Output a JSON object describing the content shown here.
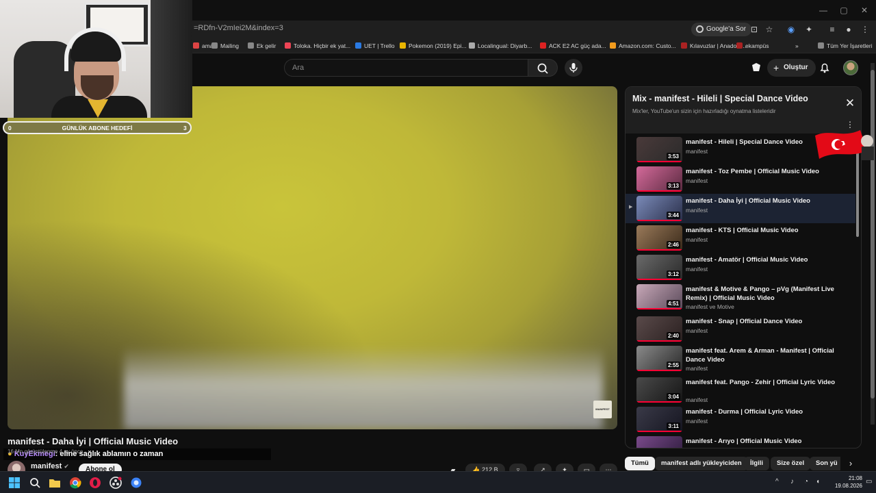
{
  "browser": {
    "url": "=RDfn-V2mIei2M&index=3",
    "google_ask": "Google'a Sor",
    "window_controls": [
      "—",
      "▢",
      "✕"
    ]
  },
  "bookmarks": [
    {
      "label": "ama",
      "color": "#d44"
    },
    {
      "label": "Mailing",
      "color": "#888"
    },
    {
      "label": "Ek gelir",
      "color": "#888"
    },
    {
      "label": "Toloka. Hiçbir ek yat...",
      "color": "#e45"
    },
    {
      "label": "UET | Trello",
      "color": "#2a7ae2"
    },
    {
      "label": "Pokemon (2019) Epi...",
      "color": "#e8b400"
    },
    {
      "label": "Localingual: Diyarb...",
      "color": "#aaa"
    },
    {
      "label": "ACK E2 AC güç ada...",
      "color": "#d22"
    },
    {
      "label": "Amazon.com: Custo...",
      "color": "#f29b1d"
    },
    {
      "label": "Kılavuzlar | Anadolu...",
      "color": "#a22"
    },
    {
      "label": "ekampüs",
      "color": "#a22"
    },
    {
      "label": "»",
      "color": ""
    },
    {
      "label": "Tüm Yer İşaretleri",
      "color": "#888"
    }
  ],
  "youtube": {
    "search_placeholder": "Ara",
    "create_label": "Oluştur"
  },
  "webcam": {
    "goal_label": "GÜNLÜK ABONE HEDEFİ",
    "goal_current": "0",
    "goal_target": "3"
  },
  "video": {
    "title": "manifest - Daha İyi | Official Music Video",
    "channel": "manifest",
    "subscribe_label": "Abone ol",
    "likes": "212 B",
    "chat_user": "KuyEkmegi",
    "chat_text": ": eline sağlık ablamın o zaman",
    "chat_ghost": "16 Mn görüntülenme  4 ay önce",
    "watermark": "MANIFEST"
  },
  "playlist": {
    "title": "Mix - manifest - Hileli | Special Dance Video",
    "subtitle": "Mix'ler, YouTube'un sizin için hazırladığı oynatma listeleridir",
    "items": [
      {
        "title": "manifest - Hileli | Special Dance Video",
        "channel": "manifest",
        "duration": "3:53",
        "active": false,
        "c1": "#4a3a3a",
        "c2": "#2a2a2a"
      },
      {
        "title": "manifest - Toz Pembe | Official Music Video",
        "channel": "manifest",
        "duration": "3:13",
        "active": false,
        "c1": "#d46a9a",
        "c2": "#5a2a40"
      },
      {
        "title": "manifest - Daha İyi | Official Music Video",
        "channel": "manifest",
        "duration": "3:44",
        "active": true,
        "c1": "#7a8ab8",
        "c2": "#2a2f4a"
      },
      {
        "title": "manifest - KTS | Official Music Video",
        "channel": "manifest",
        "duration": "2:46",
        "active": false,
        "c1": "#9a7a5a",
        "c2": "#3a2a1a"
      },
      {
        "title": "manifest - Amatör | Official Music Video",
        "channel": "manifest",
        "duration": "3:12",
        "active": false,
        "c1": "#6a6a6a",
        "c2": "#2a2a2a"
      },
      {
        "title": "manifest & Motive & Pango – pVg (Manifest Live Remix) | Official Music Video",
        "channel": "manifest ve Motive",
        "duration": "4:51",
        "active": false,
        "c1": "#c8a8b8",
        "c2": "#5a4a5a"
      },
      {
        "title": "manifest - Snap | Official Dance Video",
        "channel": "manifest",
        "duration": "2:40",
        "active": false,
        "c1": "#5a4a4a",
        "c2": "#2a2020"
      },
      {
        "title": "manifest feat. Arem & Arman - Manifest | Official Dance Video",
        "channel": "manifest",
        "duration": "2:55",
        "active": false,
        "c1": "#8a8a8a",
        "c2": "#2a2a2a"
      },
      {
        "title": "manifest feat. Pango - Zehir | Official Lyric Video",
        "channel": "manifest",
        "duration": "3:04",
        "active": false,
        "c1": "#4a4a4a",
        "c2": "#151515"
      },
      {
        "title": "manifest - Durma | Official Lyric Video",
        "channel": "manifest",
        "duration": "3:11",
        "active": false,
        "c1": "#3a3a48",
        "c2": "#151520"
      },
      {
        "title": "manifest - Arıyo | Official Music Video",
        "channel": "manifest",
        "duration": "",
        "active": false,
        "c1": "#7a4a8a",
        "c2": "#2a1a3a"
      }
    ]
  },
  "chips": [
    "Tümü",
    "manifest adlı yükleyiciden",
    "İlgili",
    "Size özel",
    "Son yü"
  ],
  "taskbar": {
    "time": "21:08",
    "date": "19.08.2026"
  }
}
